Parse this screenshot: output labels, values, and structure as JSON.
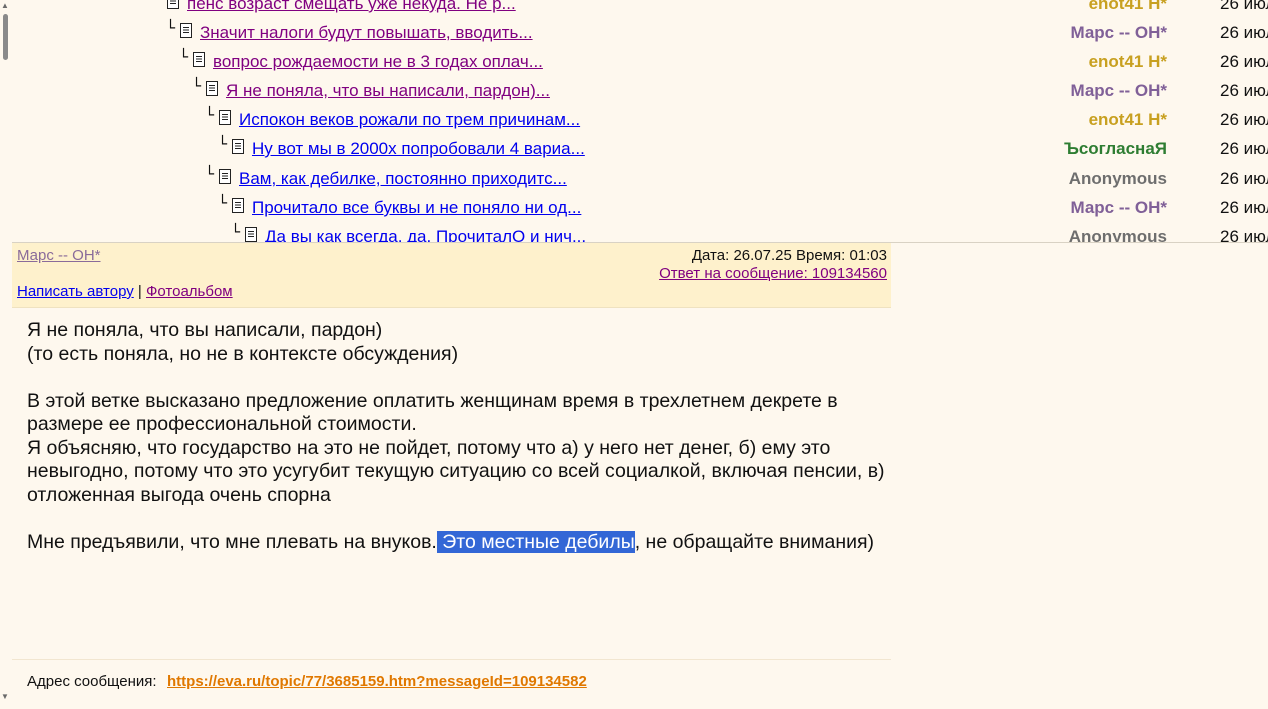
{
  "thread": {
    "rows": [
      {
        "title": "пенс возраст смещать уже некуда. Не р...",
        "author": "enot41 Н*",
        "date": "26 июл",
        "author_color": "#c8a020",
        "visited": true
      },
      {
        "title": "Значит налоги будут повышать, вводить...",
        "author": "Марс -- ОН*",
        "date": "26 июл",
        "author_color": "#806098",
        "visited": true
      },
      {
        "title": "вопрос рождаемости не в 3 годах оплач...",
        "author": "enot41 Н*",
        "date": "26 июл",
        "author_color": "#c8a020",
        "visited": true
      },
      {
        "title": "Я не поняла, что вы написали, пардон)...",
        "author": "Марс -- ОН*",
        "date": "26 июл",
        "author_color": "#806098",
        "visited": true
      },
      {
        "title": "Испокон веков рожали по трем причинам...",
        "author": "enot41 Н*",
        "date": "26 июл",
        "author_color": "#c8a020",
        "visited": false
      },
      {
        "title": "Ну вот мы в 2000х попробовали 4 вариа...",
        "author": "ЪсогласнаЯ",
        "date": "26 июл",
        "author_color": "#2e7d32",
        "visited": false
      },
      {
        "title": "Вам, как дебилке, постоянно приходитс...",
        "author": "Anonymous",
        "date": "26 июл",
        "author_color": "#6e6e6e",
        "visited": false
      },
      {
        "title": "Прочитало все буквы и не поняло ни од...",
        "author": "Марс -- ОН*",
        "date": "26 июл",
        "author_color": "#806098",
        "visited": false
      },
      {
        "title": "Да вы как всегда, да. ПрочиталО и нич...",
        "author": "Anonymous",
        "date": "26 июл",
        "author_color": "#6e6e6e",
        "visited": false
      }
    ]
  },
  "message": {
    "author": "Марс -- ОН*",
    "datetime": "Дата: 26.07.25 Время: 01:03",
    "reply_to": "Ответ на сообщение: 109134560",
    "write_author": "Написать автору",
    "separator": "|",
    "photo_album": "Фотоальбом",
    "body": {
      "p1_line1": "Я не поняла, что вы написали, пардон)",
      "p1_line2": "(то есть поняла, но не в контексте обсуждения)",
      "p2": "В этой ветке высказано предложение оплатить женщинам время в трехлетнем декрете в размере ее профессиональной стоимости.",
      "p3": "Я объясняю, что государство на это не пойдет, потому что а) у него нет денег, б) ему это невыгодно, потому что это усугубит текущую ситуацию со всей социалкой, включая пенсии, в) отложенная выгода очень спорна",
      "p4_before": "Мне предъявили, что мне плевать на внуков.",
      "p4_selected": " Это местные дебилы",
      "p4_after": ", не обращайте внимания)"
    },
    "address_label": "Адрес сообщения:",
    "address_url": "https://eva.ru/topic/77/3685159.htm?messageId=109134582"
  }
}
